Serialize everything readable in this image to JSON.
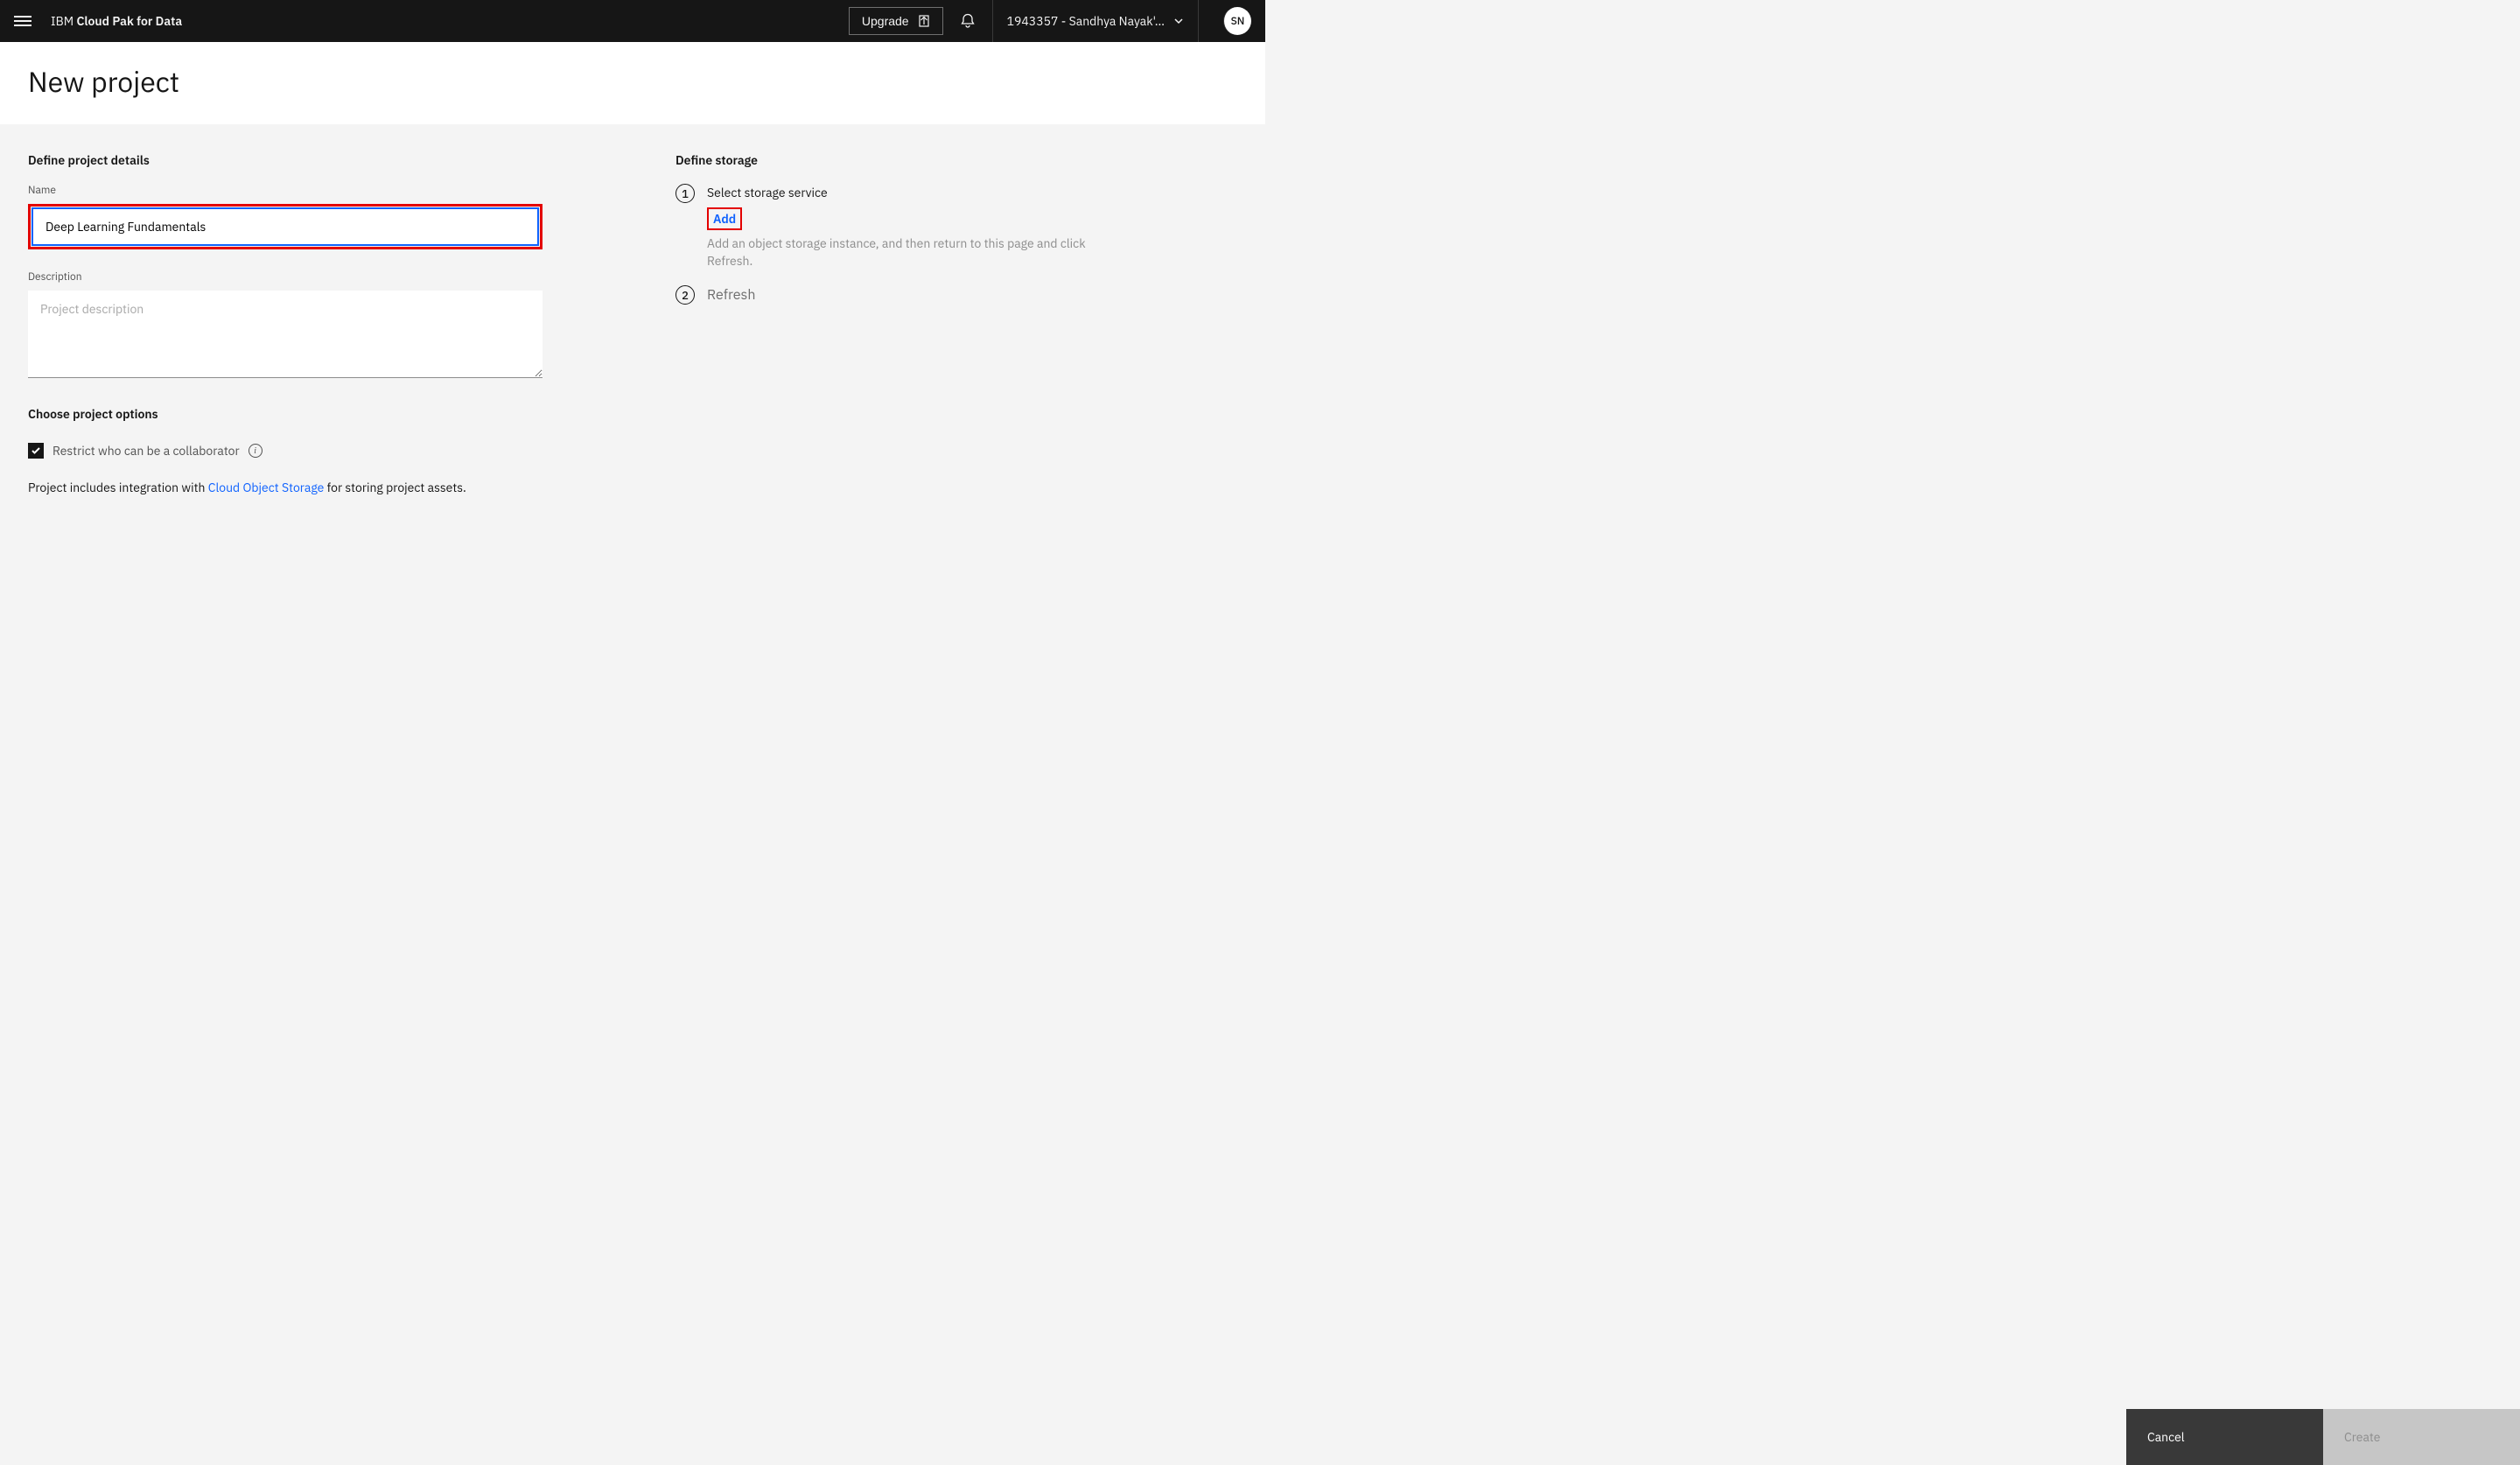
{
  "header": {
    "brand_prefix": "IBM",
    "brand_suffix": "Cloud Pak for Data",
    "upgrade_label": "Upgrade",
    "account_label": "1943357 - Sandhya Nayak'…",
    "avatar_initials": "SN"
  },
  "page": {
    "title": "New project"
  },
  "details": {
    "section_heading": "Define project details",
    "name_label": "Name",
    "name_value": "Deep Learning Fundamentals",
    "description_label": "Description",
    "description_placeholder": "Project description"
  },
  "options": {
    "section_heading": "Choose project options",
    "restrict_label": "Restrict who can be a collaborator",
    "integration_prefix": "Project includes integration with ",
    "integration_link": "Cloud Object Storage",
    "integration_suffix": " for storing project assets."
  },
  "storage": {
    "section_heading": "Define storage",
    "step1_num": "1",
    "step1_title": "Select storage service",
    "step1_add": "Add",
    "step1_help": "Add an object storage instance, and then return to this page and click Refresh.",
    "step2_num": "2",
    "step2_title": "Refresh"
  },
  "footer": {
    "cancel_label": "Cancel",
    "create_label": "Create"
  }
}
